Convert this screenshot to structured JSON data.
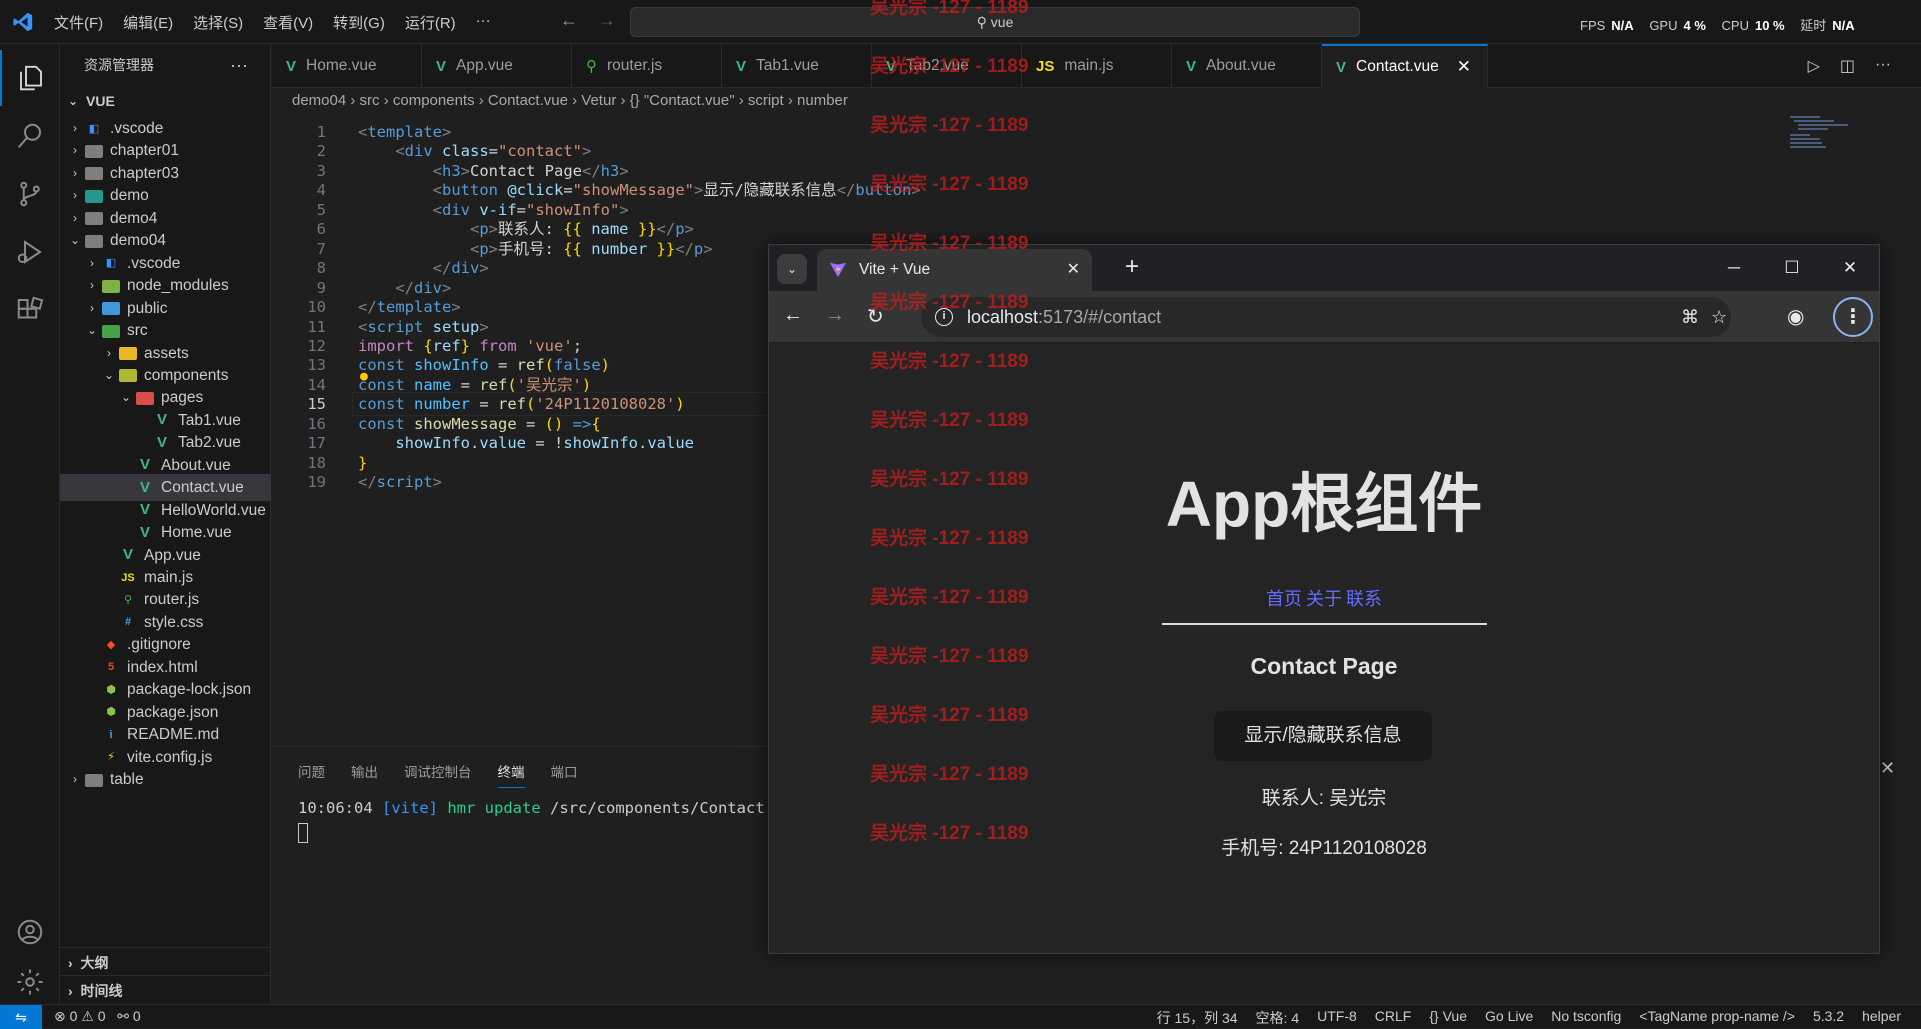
{
  "menu": [
    "文件(F)",
    "编辑(E)",
    "选择(S)",
    "查看(V)",
    "转到(G)",
    "运行(R)",
    "···"
  ],
  "command_center": "vue",
  "perf": {
    "fps_label": "FPS",
    "fps": "N/A",
    "gpu_label": "GPU",
    "gpu": "4 %",
    "cpu_label": "CPU",
    "cpu": "10 %",
    "delay_label": "延时",
    "delay": "N/A"
  },
  "explorer": {
    "title": "资源管理器",
    "root": "VUE"
  },
  "tree": [
    {
      "label": ".vscode",
      "depth": 1,
      "chev": "›",
      "icon": "vscode",
      "color": "#3794ff"
    },
    {
      "label": "chapter01",
      "depth": 1,
      "chev": "›",
      "icon": "folder",
      "color": "#8a8a8a"
    },
    {
      "label": "chapter03",
      "depth": 1,
      "chev": "›",
      "icon": "folder",
      "color": "#8a8a8a"
    },
    {
      "label": "demo",
      "depth": 1,
      "chev": "›",
      "icon": "folder",
      "color": "#26a69a"
    },
    {
      "label": "demo4",
      "depth": 1,
      "chev": "›",
      "icon": "folder",
      "color": "#8a8a8a"
    },
    {
      "label": "demo04",
      "depth": 1,
      "chev": "⌄",
      "icon": "folder-open",
      "color": "#8a8a8a"
    },
    {
      "label": ".vscode",
      "depth": 2,
      "chev": "›",
      "icon": "vscode",
      "color": "#3794ff"
    },
    {
      "label": "node_modules",
      "depth": 2,
      "chev": "›",
      "icon": "folder",
      "color": "#8bc34a"
    },
    {
      "label": "public",
      "depth": 2,
      "chev": "›",
      "icon": "folder",
      "color": "#42a5f5"
    },
    {
      "label": "src",
      "depth": 2,
      "chev": "⌄",
      "icon": "folder-open",
      "color": "#4caf50"
    },
    {
      "label": "assets",
      "depth": 3,
      "chev": "›",
      "icon": "folder",
      "color": "#ffca28"
    },
    {
      "label": "components",
      "depth": 3,
      "chev": "⌄",
      "icon": "folder-open",
      "color": "#c0ca33"
    },
    {
      "label": "pages",
      "depth": 4,
      "chev": "⌄",
      "icon": "folder-open",
      "color": "#ef5350"
    },
    {
      "label": "Tab1.vue",
      "depth": 5,
      "chev": "",
      "icon": "vue",
      "color": "#41b883"
    },
    {
      "label": "Tab2.vue",
      "depth": 5,
      "chev": "",
      "icon": "vue",
      "color": "#41b883"
    },
    {
      "label": "About.vue",
      "depth": 4,
      "chev": "",
      "icon": "vue",
      "color": "#41b883"
    },
    {
      "label": "Contact.vue",
      "depth": 4,
      "chev": "",
      "icon": "vue",
      "color": "#41b883",
      "selected": true
    },
    {
      "label": "HelloWorld.vue",
      "depth": 4,
      "chev": "",
      "icon": "vue",
      "color": "#41b883"
    },
    {
      "label": "Home.vue",
      "depth": 4,
      "chev": "",
      "icon": "vue",
      "color": "#41b883"
    },
    {
      "label": "App.vue",
      "depth": 3,
      "chev": "",
      "icon": "vue",
      "color": "#41b883"
    },
    {
      "label": "main.js",
      "depth": 3,
      "chev": "",
      "icon": "js",
      "color": "#f5de19"
    },
    {
      "label": "router.js",
      "depth": 3,
      "chev": "",
      "icon": "router",
      "color": "#4caf50"
    },
    {
      "label": "style.css",
      "depth": 3,
      "chev": "",
      "icon": "css",
      "color": "#42a5f5"
    },
    {
      "label": ".gitignore",
      "depth": 2,
      "chev": "",
      "icon": "git",
      "color": "#f4511e"
    },
    {
      "label": "index.html",
      "depth": 2,
      "chev": "",
      "icon": "html",
      "color": "#e44d26"
    },
    {
      "label": "package-lock.json",
      "depth": 2,
      "chev": "",
      "icon": "nodejs",
      "color": "#8bc34a"
    },
    {
      "label": "package.json",
      "depth": 2,
      "chev": "",
      "icon": "nodejs",
      "color": "#8bc34a"
    },
    {
      "label": "README.md",
      "depth": 2,
      "chev": "",
      "icon": "info",
      "color": "#42a5f5"
    },
    {
      "label": "vite.config.js",
      "depth": 2,
      "chev": "",
      "icon": "vite",
      "color": "#ffca28"
    },
    {
      "label": "table",
      "depth": 1,
      "chev": "›",
      "icon": "folder",
      "color": "#8a8a8a"
    }
  ],
  "outline_label": "大纲",
  "timeline_label": "时间线",
  "tabs": [
    {
      "label": "Home.vue",
      "icon": "vue"
    },
    {
      "label": "App.vue",
      "icon": "vue"
    },
    {
      "label": "router.js",
      "icon": "router"
    },
    {
      "label": "Tab1.vue",
      "icon": "vue"
    },
    {
      "label": "Tab2.vue",
      "icon": "vue"
    },
    {
      "label": "main.js",
      "icon": "js"
    },
    {
      "label": "About.vue",
      "icon": "vue"
    },
    {
      "label": "Contact.vue",
      "icon": "vue",
      "active": true
    }
  ],
  "breadcrumb": "demo04 › src › components › Contact.vue › Vetur › {} \"Contact.vue\" › script › number",
  "current_line": 15,
  "code": [
    [
      [
        "t-tag",
        "<"
      ],
      [
        "t-name",
        "template"
      ],
      [
        "t-tag",
        ">"
      ]
    ],
    [
      [
        "t-txt",
        "    "
      ],
      [
        "t-tag",
        "<"
      ],
      [
        "t-name",
        "div "
      ],
      [
        "t-attr",
        "class"
      ],
      [
        "t-txt",
        "="
      ],
      [
        "t-str",
        "\"contact\""
      ],
      [
        "t-tag",
        ">"
      ]
    ],
    [
      [
        "t-txt",
        "        "
      ],
      [
        "t-tag",
        "<"
      ],
      [
        "t-name",
        "h3"
      ],
      [
        "t-tag",
        ">"
      ],
      [
        "t-txt",
        "Contact Page"
      ],
      [
        "t-tag",
        "</"
      ],
      [
        "t-name",
        "h3"
      ],
      [
        "t-tag",
        ">"
      ]
    ],
    [
      [
        "t-txt",
        "        "
      ],
      [
        "t-tag",
        "<"
      ],
      [
        "t-name",
        "button "
      ],
      [
        "t-attr",
        "@click"
      ],
      [
        "t-txt",
        "="
      ],
      [
        "t-str",
        "\"showMessage\""
      ],
      [
        "t-tag",
        ">"
      ],
      [
        "t-txt",
        "显示/隐藏联系信息"
      ],
      [
        "t-tag",
        "</"
      ],
      [
        "t-name",
        "button"
      ],
      [
        "t-tag",
        ">"
      ]
    ],
    [
      [
        "t-txt",
        "        "
      ],
      [
        "t-tag",
        "<"
      ],
      [
        "t-name",
        "div "
      ],
      [
        "t-attr",
        "v-if"
      ],
      [
        "t-txt",
        "="
      ],
      [
        "t-str",
        "\"showInfo\""
      ],
      [
        "t-tag",
        ">"
      ]
    ],
    [
      [
        "t-txt",
        "            "
      ],
      [
        "t-tag",
        "<"
      ],
      [
        "t-name",
        "p"
      ],
      [
        "t-tag",
        ">"
      ],
      [
        "t-txt",
        "联系人: "
      ],
      [
        "t-br",
        "{{"
      ],
      [
        "t-var",
        " name "
      ],
      [
        "t-br",
        "}}"
      ],
      [
        "t-tag",
        "</"
      ],
      [
        "t-name",
        "p"
      ],
      [
        "t-tag",
        ">"
      ]
    ],
    [
      [
        "t-txt",
        "            "
      ],
      [
        "t-tag",
        "<"
      ],
      [
        "t-name",
        "p"
      ],
      [
        "t-tag",
        ">"
      ],
      [
        "t-txt",
        "手机号: "
      ],
      [
        "t-br",
        "{{"
      ],
      [
        "t-var",
        " number "
      ],
      [
        "t-br",
        "}}"
      ],
      [
        "t-tag",
        "</"
      ],
      [
        "t-name",
        "p"
      ],
      [
        "t-tag",
        ">"
      ]
    ],
    [
      [
        "t-txt",
        "        "
      ],
      [
        "t-tag",
        "</"
      ],
      [
        "t-name",
        "div"
      ],
      [
        "t-tag",
        ">"
      ]
    ],
    [
      [
        "t-txt",
        "    "
      ],
      [
        "t-tag",
        "</"
      ],
      [
        "t-name",
        "div"
      ],
      [
        "t-tag",
        ">"
      ]
    ],
    [
      [
        "t-tag",
        "</"
      ],
      [
        "t-name",
        "template"
      ],
      [
        "t-tag",
        ">"
      ]
    ],
    [
      [
        "t-tag",
        "<"
      ],
      [
        "t-name",
        "script "
      ],
      [
        "t-attr",
        "setup"
      ],
      [
        "t-tag",
        ">"
      ]
    ],
    [
      [
        "t-kw",
        "import "
      ],
      [
        "t-br",
        "{"
      ],
      [
        "t-var",
        "ref"
      ],
      [
        "t-br",
        "}"
      ],
      [
        "t-kw",
        " from "
      ],
      [
        "t-str",
        "'vue'"
      ],
      [
        "t-txt",
        ";"
      ]
    ],
    [
      [
        "t-name",
        "const "
      ],
      [
        "t-con",
        "showInfo"
      ],
      [
        "t-txt",
        " = "
      ],
      [
        "t-fn",
        "ref"
      ],
      [
        "t-br",
        "("
      ],
      [
        "t-name",
        "false"
      ],
      [
        "t-br",
        ")"
      ]
    ],
    [
      [
        "t-name",
        "const "
      ],
      [
        "t-con",
        "name"
      ],
      [
        "t-txt",
        " = "
      ],
      [
        "t-fn",
        "ref"
      ],
      [
        "t-br",
        "("
      ],
      [
        "t-str",
        "'吴光宗'"
      ],
      [
        "t-br",
        ")"
      ]
    ],
    [
      [
        "t-name",
        "const "
      ],
      [
        "t-con",
        "number"
      ],
      [
        "t-txt",
        " = "
      ],
      [
        "t-fn",
        "ref"
      ],
      [
        "t-br",
        "("
      ],
      [
        "t-str",
        "'24P1120108028'"
      ],
      [
        "t-br",
        ")"
      ]
    ],
    [
      [
        "t-name",
        "const "
      ],
      [
        "t-fn",
        "showMessage"
      ],
      [
        "t-txt",
        " = "
      ],
      [
        "t-br",
        "()"
      ],
      [
        "t-name",
        " =>"
      ],
      [
        "t-br",
        "{"
      ]
    ],
    [
      [
        "t-txt",
        "    "
      ],
      [
        "t-var",
        "showInfo"
      ],
      [
        "t-txt",
        "."
      ],
      [
        "t-var",
        "value"
      ],
      [
        "t-txt",
        " = !"
      ],
      [
        "t-var",
        "showInfo"
      ],
      [
        "t-txt",
        "."
      ],
      [
        "t-var",
        "value"
      ]
    ],
    [
      [
        "t-br",
        "}"
      ]
    ],
    [
      [
        "t-tag",
        "</"
      ],
      [
        "t-name",
        "script"
      ],
      [
        "t-tag",
        ">"
      ]
    ]
  ],
  "panel_tabs": [
    "问题",
    "输出",
    "调试控制台",
    "终端",
    "端口"
  ],
  "terminal": {
    "time": "10:06:04",
    "tag": "[vite]",
    "msg": "hmr update",
    "path": "/src/components/Contact.vue"
  },
  "status": {
    "errors": "⊗ 0 ⚠ 0",
    "ports": "⚯ 0",
    "right": [
      "行 15，列 34",
      "空格: 4",
      "UTF-8",
      "CRLF",
      "{} Vue",
      "Go Live",
      "No tsconfig",
      "<TagName prop-name />",
      "5.3.2",
      "helper"
    ]
  },
  "browser": {
    "tab_title": "Vite + Vue",
    "url_host": "localhost",
    "url_rest": ":5173/#/contact",
    "page": {
      "h1": "App根组件",
      "nav": [
        "首页",
        "关于",
        "联系"
      ],
      "h3": "Contact Page",
      "button": "显示/隐藏联系信息",
      "contact": "联系人: 吴光宗",
      "phone": "手机号: 24P1120108028"
    }
  },
  "watermark": "吴光宗 -127 - 1189"
}
